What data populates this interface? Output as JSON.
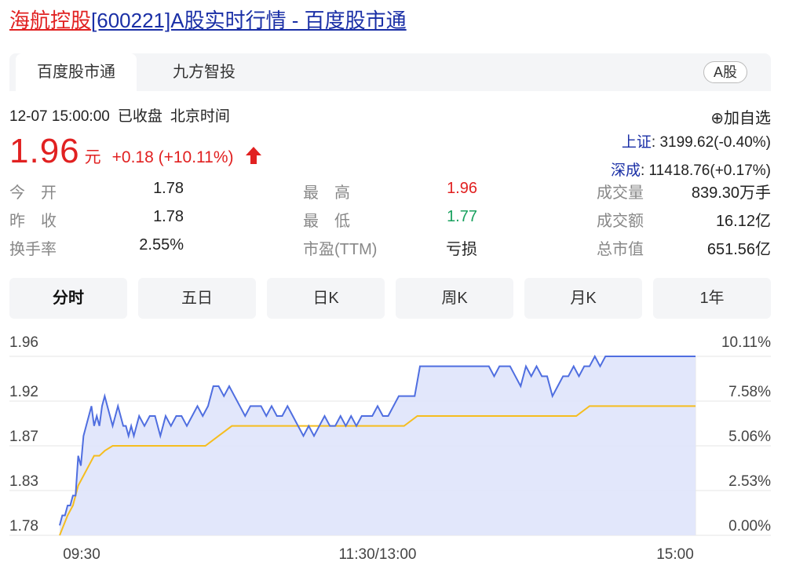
{
  "page_title": {
    "name_link": "海航控股",
    "rest": "[600221]A股实时行情 - 百度股市通"
  },
  "tabs": [
    {
      "label": "百度股市通",
      "active": true
    },
    {
      "label": "九方智投",
      "active": false
    }
  ],
  "market_badge": "A股",
  "status": {
    "datetime": "12-07 15:00:00",
    "state": "已收盘",
    "tz": "北京时间"
  },
  "quote": {
    "price": "1.96",
    "unit": "元",
    "change": "+0.18 (+10.11%)",
    "direction": "up"
  },
  "add_watch": "⊕加自选",
  "indices": [
    {
      "label": "上证",
      "value": ": 3199.62(-0.40%)"
    },
    {
      "label": "深成",
      "value": ": 11418.76(+0.17%)"
    }
  ],
  "stats": {
    "col1": [
      {
        "label": "今　开",
        "value": "1.78"
      },
      {
        "label": "昨　收",
        "value": "1.78"
      },
      {
        "label": "换手率",
        "value": "2.55%"
      }
    ],
    "col2": [
      {
        "label": "最　高",
        "value": "1.96",
        "color": "red"
      },
      {
        "label": "最　低",
        "value": "1.77",
        "color": "green"
      },
      {
        "label": "市盈(TTM)",
        "value": "亏损",
        "color": ""
      }
    ],
    "col3": [
      {
        "label": "成交量",
        "value": "839.30万手"
      },
      {
        "label": "成交额",
        "value": "16.12亿"
      },
      {
        "label": "总市值",
        "value": "651.56亿"
      }
    ]
  },
  "periods": [
    {
      "label": "分时",
      "active": true
    },
    {
      "label": "五日",
      "active": false
    },
    {
      "label": "日K",
      "active": false
    },
    {
      "label": "周K",
      "active": false
    },
    {
      "label": "月K",
      "active": false
    },
    {
      "label": "1年",
      "active": false
    }
  ],
  "colors": {
    "up": "#e12121",
    "down": "#19a15f",
    "price_line": "#4f6ee0",
    "avg_line": "#f5bd1f",
    "fill": "#dfe4fb"
  },
  "chart_data": {
    "type": "line",
    "y_left_ticks": [
      "1.96",
      "1.92",
      "1.87",
      "1.83",
      "1.78"
    ],
    "y_right_ticks": [
      "10.11%",
      "7.58%",
      "5.06%",
      "2.53%",
      "0.00%"
    ],
    "x_ticks": [
      "09:30",
      "11:30/13:00",
      "15:00"
    ],
    "ylim": [
      1.78,
      1.96
    ],
    "xlim": [
      0,
      240
    ],
    "series": [
      {
        "x": [
          0,
          1,
          2,
          3,
          4,
          5,
          6,
          7,
          8,
          9,
          10,
          11,
          12,
          13,
          14,
          15,
          16,
          17,
          18,
          19,
          20,
          21,
          22,
          23,
          24,
          25,
          26,
          27,
          28,
          29,
          30,
          32,
          34,
          36,
          38,
          40,
          42,
          44,
          46,
          48,
          50,
          52,
          54,
          56,
          58,
          60,
          62,
          64,
          66,
          68,
          70,
          72,
          74,
          76,
          78,
          80,
          82,
          84,
          86,
          88,
          90,
          92,
          94,
          96,
          98,
          100,
          102,
          104,
          106,
          108,
          110,
          112,
          114,
          116,
          118,
          120,
          122,
          124,
          126,
          128,
          130,
          132,
          134,
          136,
          138,
          140,
          142,
          144,
          146,
          148,
          150,
          152,
          154,
          156,
          158,
          160,
          162,
          164,
          166,
          168,
          170,
          172,
          174,
          176,
          178,
          180,
          182,
          184,
          186,
          188,
          190,
          192,
          194,
          196,
          198,
          200,
          202,
          204,
          206,
          208,
          210,
          212,
          214,
          216,
          218,
          220,
          222,
          224,
          226,
          228,
          230,
          232,
          234,
          236,
          238,
          240
        ],
        "values": [
          1.79,
          1.8,
          1.8,
          1.81,
          1.81,
          1.82,
          1.82,
          1.86,
          1.85,
          1.88,
          1.89,
          1.9,
          1.91,
          1.89,
          1.9,
          1.89,
          1.91,
          1.92,
          1.91,
          1.9,
          1.89,
          1.9,
          1.91,
          1.9,
          1.89,
          1.89,
          1.88,
          1.89,
          1.88,
          1.89,
          1.9,
          1.89,
          1.9,
          1.9,
          1.88,
          1.9,
          1.89,
          1.9,
          1.9,
          1.89,
          1.9,
          1.91,
          1.9,
          1.91,
          1.93,
          1.93,
          1.92,
          1.93,
          1.92,
          1.91,
          1.9,
          1.91,
          1.91,
          1.91,
          1.9,
          1.91,
          1.9,
          1.9,
          1.91,
          1.9,
          1.89,
          1.88,
          1.89,
          1.88,
          1.89,
          1.9,
          1.89,
          1.89,
          1.9,
          1.89,
          1.9,
          1.89,
          1.9,
          1.9,
          1.9,
          1.91,
          1.9,
          1.9,
          1.91,
          1.92,
          1.92,
          1.92,
          1.92,
          1.95,
          1.95,
          1.95,
          1.95,
          1.95,
          1.95,
          1.95,
          1.95,
          1.95,
          1.95,
          1.95,
          1.95,
          1.95,
          1.95,
          1.94,
          1.95,
          1.95,
          1.95,
          1.94,
          1.93,
          1.95,
          1.94,
          1.95,
          1.94,
          1.94,
          1.92,
          1.93,
          1.94,
          1.94,
          1.95,
          1.94,
          1.95,
          1.95,
          1.96,
          1.95,
          1.96,
          1.96,
          1.96,
          1.96,
          1.96,
          1.96,
          1.96,
          1.96,
          1.96,
          1.96,
          1.96,
          1.96,
          1.96,
          1.96,
          1.96,
          1.96,
          1.96,
          1.96
        ]
      },
      {
        "x": [
          0,
          3,
          5,
          7,
          9,
          11,
          13,
          15,
          17,
          20,
          25,
          30,
          35,
          40,
          45,
          50,
          55,
          60,
          65,
          70,
          75,
          80,
          85,
          90,
          95,
          100,
          105,
          110,
          115,
          120,
          125,
          130,
          135,
          140,
          145,
          150,
          155,
          160,
          165,
          170,
          175,
          180,
          185,
          190,
          195,
          200,
          205,
          210,
          215,
          220,
          225,
          230,
          235,
          240
        ],
        "values": [
          1.78,
          1.8,
          1.81,
          1.83,
          1.84,
          1.85,
          1.86,
          1.86,
          1.865,
          1.87,
          1.87,
          1.87,
          1.87,
          1.87,
          1.87,
          1.87,
          1.87,
          1.88,
          1.89,
          1.89,
          1.89,
          1.89,
          1.89,
          1.89,
          1.89,
          1.89,
          1.89,
          1.89,
          1.89,
          1.89,
          1.89,
          1.89,
          1.9,
          1.9,
          1.9,
          1.9,
          1.9,
          1.9,
          1.9,
          1.9,
          1.9,
          1.9,
          1.9,
          1.9,
          1.9,
          1.91,
          1.91,
          1.91,
          1.91,
          1.91,
          1.91,
          1.91,
          1.91,
          1.91
        ]
      }
    ]
  }
}
